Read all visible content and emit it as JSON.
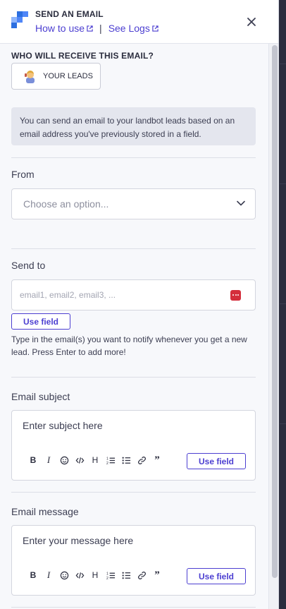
{
  "header": {
    "title": "SEND AN EMAIL",
    "how_to_use": "How to use",
    "separator": "|",
    "see_logs": "See Logs",
    "brand_colors": [
      "#4f86f7",
      "#2c6fe0",
      "#8fb5fb"
    ]
  },
  "recipients": {
    "label": "WHO WILL RECEIVE THIS EMAIL?",
    "button_label": "YOUR LEADS",
    "info_text": "You can send an email to your landbot leads based on an email address you've previously stored in a field."
  },
  "from": {
    "label": "From",
    "placeholder": "Choose an option..."
  },
  "send_to": {
    "label": "Send to",
    "placeholder": "email1, email2, email3, ...",
    "use_field": "Use field",
    "help": "Type in the email(s) you want to notify whenever you get a new lead. Press Enter to add more!"
  },
  "subject": {
    "label": "Email subject",
    "placeholder": "Enter subject here",
    "use_field": "Use field"
  },
  "message": {
    "label": "Email message",
    "placeholder": "Enter your message here",
    "use_field": "Use field"
  },
  "toolbar_items": [
    "bold-icon",
    "italic-icon",
    "emoji-icon",
    "code-icon",
    "heading-icon",
    "numbered-list-icon",
    "bullet-list-icon",
    "link-icon",
    "quote-icon"
  ],
  "colors": {
    "accent": "#4c3fd1",
    "danger": "#d42e3c"
  }
}
